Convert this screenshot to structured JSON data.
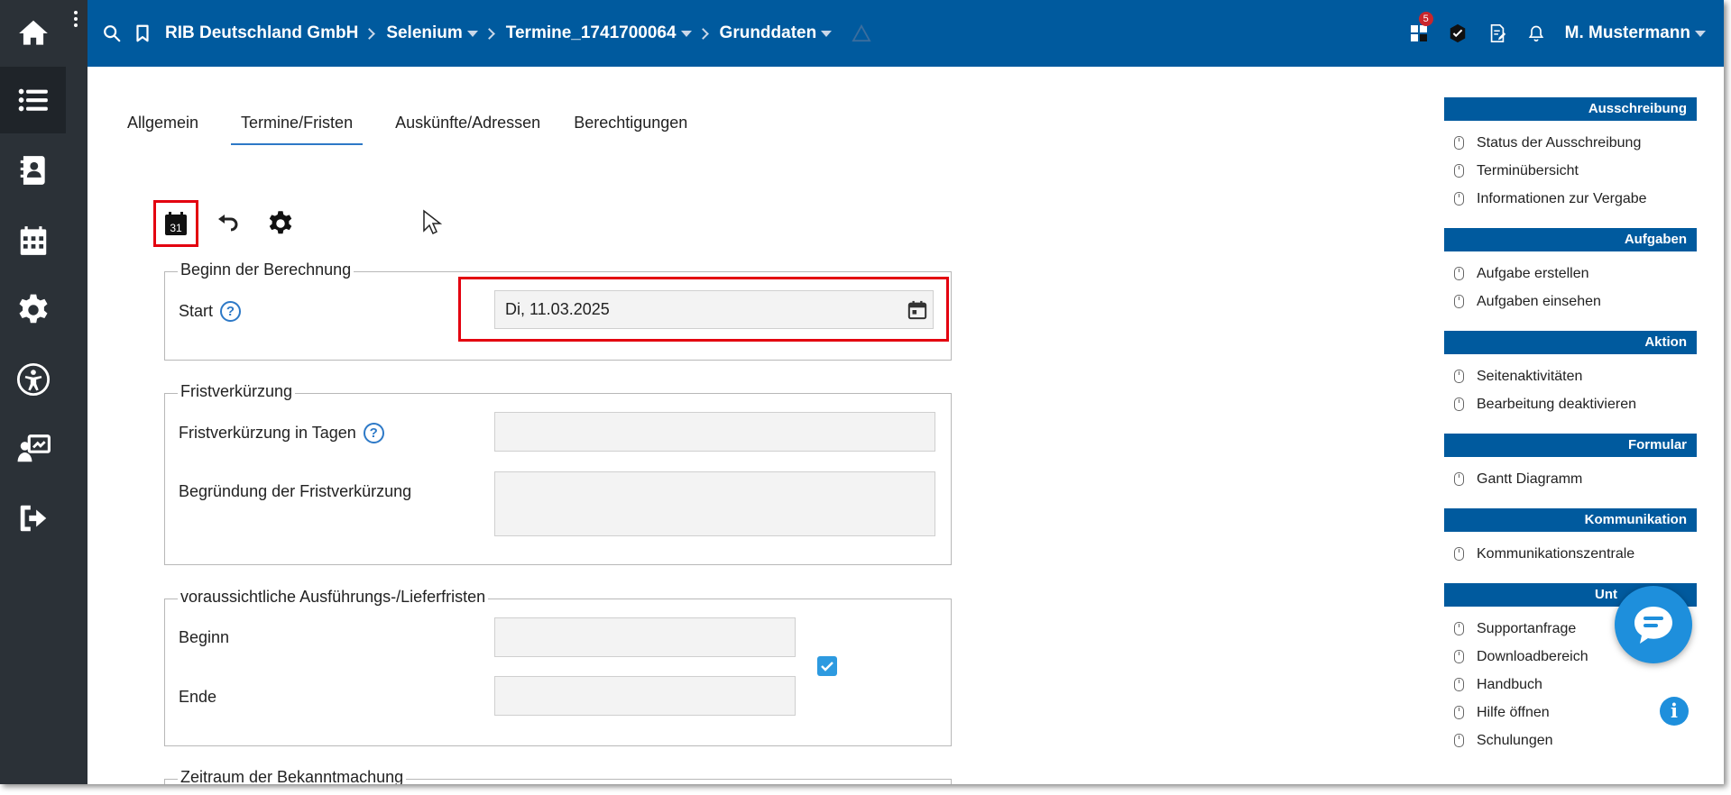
{
  "header": {
    "org": "RIB Deutschland GmbH",
    "project": "Selenium",
    "entity": "Termine_1741700064",
    "section": "Grunddaten",
    "notification_count": "5",
    "user": "M. Mustermann"
  },
  "rail": {
    "items": [
      "home-icon",
      "list-icon",
      "contacts-icon",
      "calendar-icon",
      "gear-icon",
      "accessibility-icon",
      "presentation-icon",
      "logout-icon"
    ]
  },
  "tabs": [
    "Allgemein",
    "Termine/Fristen",
    "Auskünfte/Adressen",
    "Berechtigungen"
  ],
  "toolbar": {
    "calendar_day": "31"
  },
  "form": {
    "berechnung": {
      "legend": "Beginn der Berechnung",
      "start_label": "Start",
      "start_value": "Di, 11.03.2025"
    },
    "fristverkuerzung": {
      "legend": "Fristverkürzung",
      "tage_label": "Fristverkürzung in Tagen",
      "tage_value": "",
      "begruendung_label": "Begründung der Fristverkürzung",
      "begruendung_value": ""
    },
    "ausfuehrung": {
      "legend": "voraussichtliche Ausführungs-/Lieferfristen",
      "beginn_label": "Beginn",
      "beginn_value": "",
      "ende_label": "Ende",
      "ende_value": "",
      "checked": true
    },
    "bekanntmachung": {
      "legend": "Zeitraum der Bekanntmachung"
    },
    "help_glyph": "?"
  },
  "sidebar": {
    "groups": [
      {
        "title": "Ausschreibung",
        "items": [
          "Status der Ausschreibung",
          "Terminübersicht",
          "Informationen zur Vergabe"
        ]
      },
      {
        "title": "Aufgaben",
        "items": [
          "Aufgabe erstellen",
          "Aufgaben einsehen"
        ]
      },
      {
        "title": "Aktion",
        "items": [
          "Seitenaktivitäten",
          "Bearbeitung deaktivieren"
        ]
      },
      {
        "title": "Formular",
        "items": [
          "Gantt Diagramm"
        ]
      },
      {
        "title": "Kommunikation",
        "items": [
          "Kommunikationszentrale"
        ]
      },
      {
        "title": "Unt",
        "items": [
          "Supportanfrage",
          "Downloadbereich",
          "Handbuch",
          "Hilfe öffnen",
          "Schulungen"
        ]
      }
    ]
  },
  "colors": {
    "brand": "#005a9e",
    "rail": "#2b3137",
    "highlight": "#e3000f",
    "accent": "#2d79c7"
  }
}
